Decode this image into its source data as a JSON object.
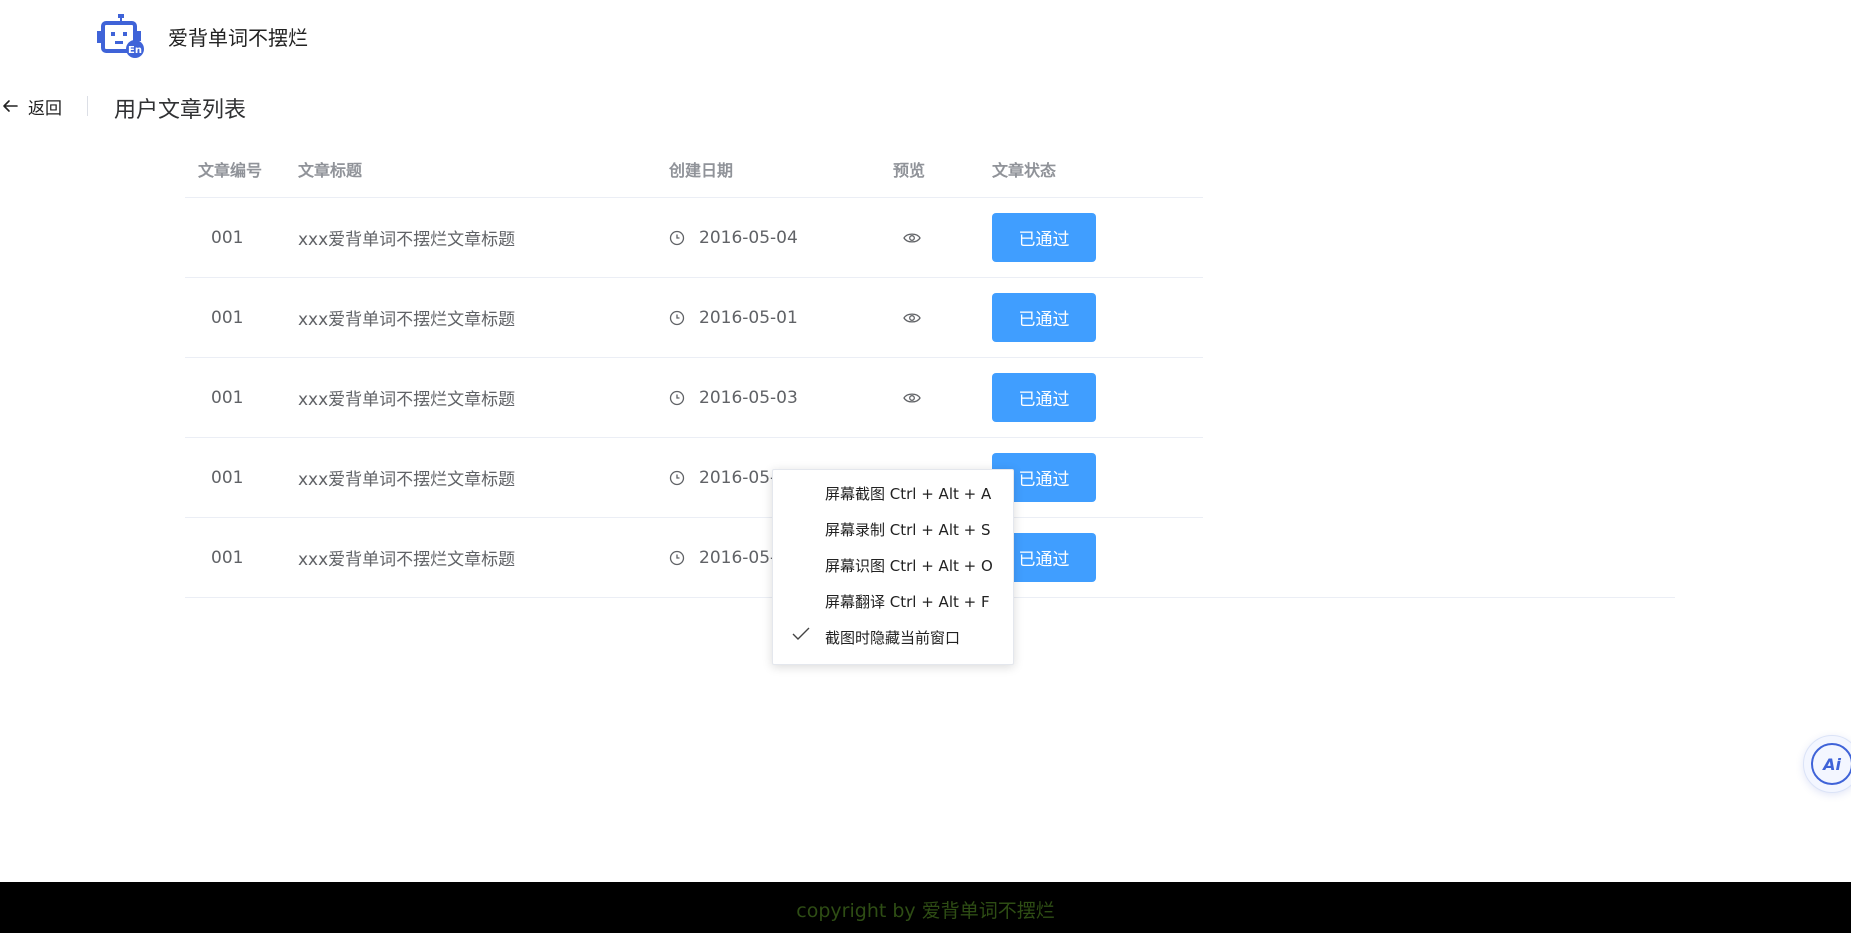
{
  "header": {
    "app_title": "爱背单词不摆烂",
    "logo_badge": "En"
  },
  "page_header": {
    "back_label": "返回",
    "title": "用户文章列表"
  },
  "table": {
    "columns": [
      "文章编号",
      "文章标题",
      "创建日期",
      "预览",
      "文章状态"
    ],
    "rows": [
      {
        "id": "001",
        "title": "xxx爱背单词不摆烂文章标题",
        "date": "2016-05-04",
        "status": "已通过"
      },
      {
        "id": "001",
        "title": "xxx爱背单词不摆烂文章标题",
        "date": "2016-05-01",
        "status": "已通过"
      },
      {
        "id": "001",
        "title": "xxx爱背单词不摆烂文章标题",
        "date": "2016-05-03",
        "status": "已通过"
      },
      {
        "id": "001",
        "title": "xxx爱背单词不摆烂文章标题",
        "date": "2016-05-03",
        "status": "已通过"
      },
      {
        "id": "001",
        "title": "xxx爱背单词不摆烂文章标题",
        "date": "2016-05-03",
        "status": "已通过"
      }
    ]
  },
  "context_menu": {
    "items": [
      "屏幕截图 Ctrl + Alt + A",
      "屏幕录制 Ctrl + Alt + S",
      "屏幕识图 Ctrl + Alt + O",
      "屏幕翻译 Ctrl + Alt + F",
      "截图时隐藏当前窗口"
    ]
  },
  "ai_button": {
    "label": "Ai"
  },
  "footer": {
    "text": "copyright by 爱背单词不摆烂"
  },
  "colors": {
    "primary": "#409eff",
    "logo": "#3f63d8",
    "footer_bg": "#000000",
    "footer_text": "#2e4d14",
    "header_text": "#909399"
  }
}
